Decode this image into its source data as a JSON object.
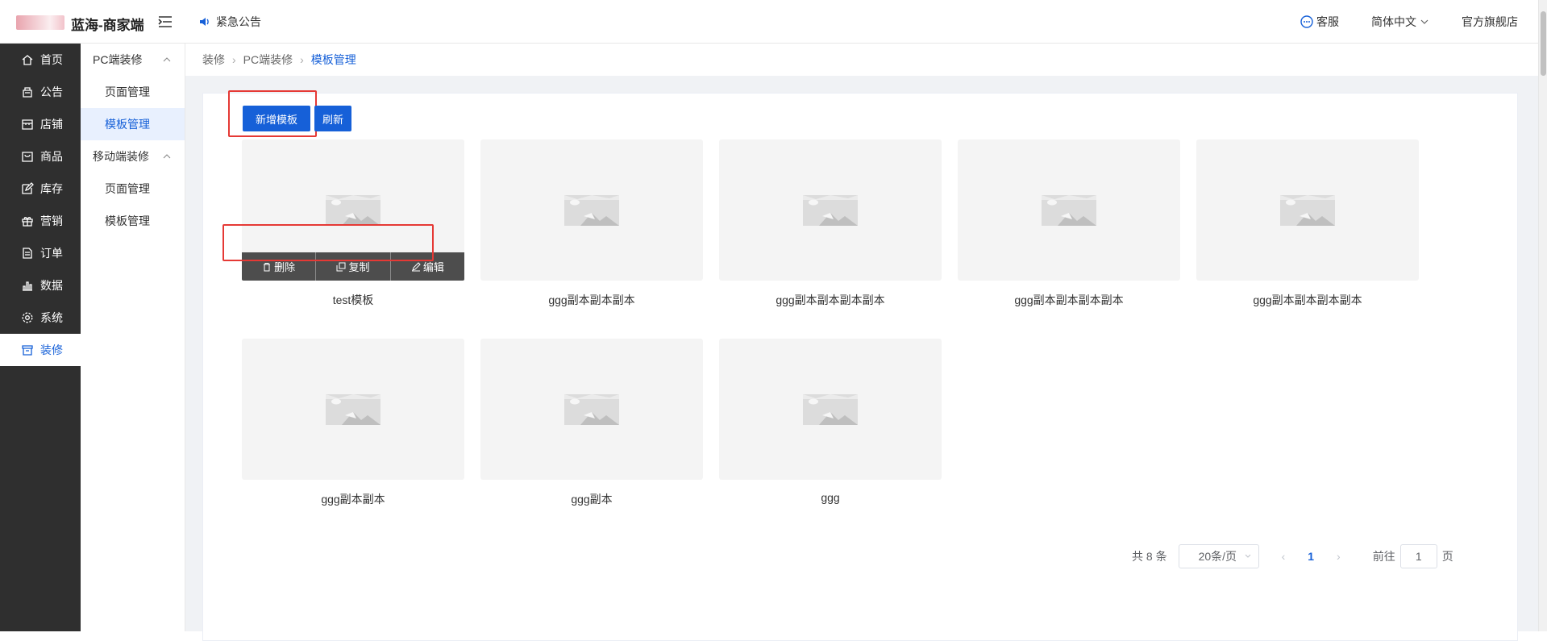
{
  "header": {
    "brand": "蓝海-商家端",
    "notice": "紧急公告",
    "service": "客服",
    "language": "简体中文",
    "store": "官方旗舰店"
  },
  "sidebar": {
    "items": [
      {
        "label": "首页",
        "icon": "home-icon"
      },
      {
        "label": "公告",
        "icon": "notice-icon"
      },
      {
        "label": "店铺",
        "icon": "shop-icon"
      },
      {
        "label": "商品",
        "icon": "goods-icon"
      },
      {
        "label": "库存",
        "icon": "edit-icon"
      },
      {
        "label": "营销",
        "icon": "gift-icon"
      },
      {
        "label": "订单",
        "icon": "order-icon"
      },
      {
        "label": "数据",
        "icon": "chart-icon"
      },
      {
        "label": "系统",
        "icon": "gear-icon"
      },
      {
        "label": "装修",
        "icon": "decorate-icon"
      }
    ],
    "active_index": 9
  },
  "subnav": {
    "group1": "PC端装修",
    "group1_items": [
      "页面管理",
      "模板管理"
    ],
    "group2": "移动端装修",
    "group2_items": [
      "页面管理",
      "模板管理"
    ]
  },
  "breadcrumb": [
    "装修",
    "PC端装修",
    "模板管理"
  ],
  "toolbar": {
    "add_label": "新增模板",
    "refresh_label": "刷新"
  },
  "templates": [
    {
      "name": "test模板"
    },
    {
      "name": "ggg副本副本副本"
    },
    {
      "name": "ggg副本副本副本副本"
    },
    {
      "name": "ggg副本副本副本副本"
    },
    {
      "name": "ggg副本副本副本副本"
    },
    {
      "name": "ggg副本副本"
    },
    {
      "name": "ggg副本"
    },
    {
      "name": "ggg"
    }
  ],
  "card_actions": {
    "delete": "删除",
    "copy": "复制",
    "edit": "编辑"
  },
  "pagination": {
    "total": "共 8 条",
    "page_size": "20条/页",
    "current_page": "1",
    "goto_prefix": "前往",
    "goto_value": "1",
    "goto_suffix": "页"
  },
  "colors": {
    "primary": "#1660d8",
    "sidebar_bg": "#2f2f2f",
    "highlight": "#e53935"
  }
}
